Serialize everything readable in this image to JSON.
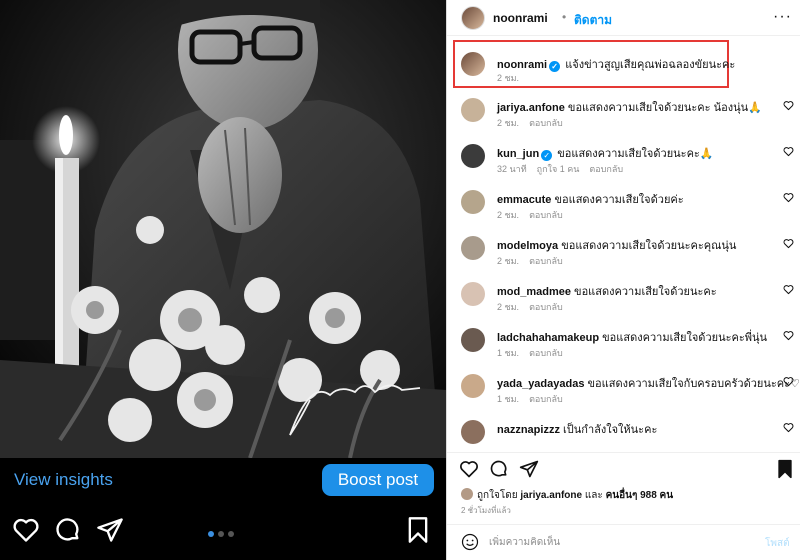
{
  "left_panel": {
    "signature_text": "Jakamin",
    "view_insights": "View insights",
    "boost_post": "Boost post",
    "carousel_dots": 3,
    "active_dot": 0
  },
  "header": {
    "username": "noonrami",
    "separator": "•",
    "follow_label": "ติดตาม",
    "more_label": "···"
  },
  "caption": {
    "username": "noonrami",
    "text": "แจ้งข่าวสูญเสียคุณพ่อฉลองขัยนะคะ",
    "time": "2 ชม."
  },
  "comments": [
    {
      "username": "jariya.anfone",
      "text": "ขอแสดงความเสียใจด้วยนะคะ น้องนุ่น🙏",
      "time": "2 ชม.",
      "likes": "",
      "reply": "ตอบกลับ",
      "verified": false
    },
    {
      "username": "kun_jun",
      "text": "ขอแสดงความเสียใจด้วยนะคะ🙏",
      "time": "32 นาที",
      "likes": "ถูกใจ 1 คน",
      "reply": "ตอบกลับ",
      "verified": true
    },
    {
      "username": "emmacute",
      "text": "ขอแสดงความเสียใจด้วยค่ะ",
      "time": "2 ชม.",
      "likes": "",
      "reply": "ตอบกลับ",
      "verified": false
    },
    {
      "username": "modelmoya",
      "text": "ขอแสดงความเสียใจด้วยนะคะคุณนุ่น",
      "time": "2 ชม.",
      "likes": "",
      "reply": "ตอบกลับ",
      "verified": false
    },
    {
      "username": "mod_madmee",
      "text": "ขอแสดงความเสียใจด้วยนะคะ",
      "time": "2 ชม.",
      "likes": "",
      "reply": "ตอบกลับ",
      "verified": false
    },
    {
      "username": "ladchahahamakeup",
      "text": "ขอแสดงความเสียใจด้วยนะคะพี่นุ่น",
      "time": "1 ชม.",
      "likes": "",
      "reply": "ตอบกลับ",
      "verified": false
    },
    {
      "username": "yada_yadayadas",
      "text": "ขอแสดงความเสียใจกับครอบครัวด้วยนะคะ♡",
      "time": "1 ชม.",
      "likes": "",
      "reply": "ตอบกลับ",
      "verified": false
    },
    {
      "username": "nazznapizzz",
      "text": "เป็นกำลังใจให้นะคะ",
      "time": "",
      "likes": "",
      "reply": "",
      "verified": false
    }
  ],
  "likes_line": {
    "prefix": "ถูกใจโดย",
    "user": "jariya.anfone",
    "middle": "และ",
    "others": "คนอื่นๆ 988 คน"
  },
  "post_time": "2 ชั่วโมงที่แล้ว",
  "add_comment": {
    "placeholder": "เพิ่มความคิดเห็น",
    "post_label": "โพสต์"
  }
}
